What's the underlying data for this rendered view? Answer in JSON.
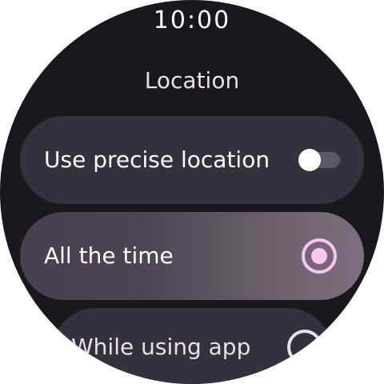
{
  "status_bar": {
    "time": "10:00"
  },
  "screen": {
    "title": "Location"
  },
  "options": {
    "precise": {
      "label": "Use precise location",
      "toggle_on": false
    },
    "always": {
      "label": "All the time",
      "selected": true
    },
    "while_using": {
      "label": "While using app",
      "selected": false
    }
  },
  "colors": {
    "background": "#1a181d",
    "chip": "#35303d",
    "accent": "#f7c6f2",
    "text": "#ffffff"
  },
  "icons": {
    "toggle": "toggle-switch-icon",
    "radio_selected": "radio-selected-icon",
    "radio_unselected": "radio-unselected-icon"
  }
}
